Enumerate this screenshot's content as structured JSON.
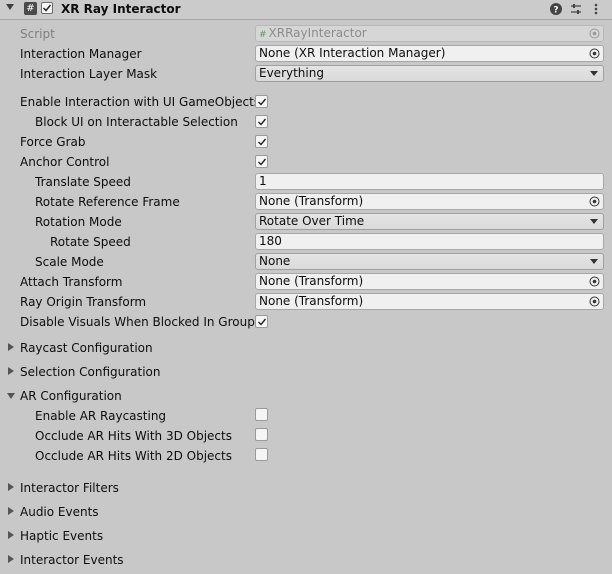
{
  "component": {
    "title": "XR Ray Interactor",
    "enabled": true,
    "icons": [
      "help-icon",
      "presets-icon",
      "more-options-icon"
    ]
  },
  "fields": {
    "script": {
      "label": "Script",
      "value": "XRRayInteractor"
    },
    "interaction_manager": {
      "label": "Interaction Manager",
      "value": "None (XR Interaction Manager)"
    },
    "interaction_layer_mask": {
      "label": "Interaction Layer Mask",
      "value": "Everything"
    },
    "enable_ui": {
      "label": "Enable Interaction with UI GameObjects",
      "checked": true
    },
    "block_ui": {
      "label": "Block UI on Interactable Selection",
      "checked": true
    },
    "force_grab": {
      "label": "Force Grab",
      "checked": true
    },
    "anchor_control": {
      "label": "Anchor Control",
      "checked": true
    },
    "translate_speed": {
      "label": "Translate Speed",
      "value": "1"
    },
    "rotate_reference_frame": {
      "label": "Rotate Reference Frame",
      "value": "None (Transform)"
    },
    "rotation_mode": {
      "label": "Rotation Mode",
      "value": "Rotate Over Time"
    },
    "rotate_speed": {
      "label": "Rotate Speed",
      "value": "180"
    },
    "scale_mode": {
      "label": "Scale Mode",
      "value": "None"
    },
    "attach_transform": {
      "label": "Attach Transform",
      "value": "None (Transform)"
    },
    "ray_origin_transform": {
      "label": "Ray Origin Transform",
      "value": "None (Transform)"
    },
    "disable_visuals": {
      "label": "Disable Visuals When Blocked In Group",
      "checked": true
    }
  },
  "sections": {
    "raycast": "Raycast Configuration",
    "selection": "Selection Configuration",
    "ar": "AR Configuration",
    "filters": "Interactor Filters",
    "audio": "Audio Events",
    "haptic": "Haptic Events",
    "interactor_events": "Interactor Events"
  },
  "ar": {
    "enable_ar_raycasting": {
      "label": "Enable AR Raycasting",
      "checked": false
    },
    "occlude_3d": {
      "label": "Occlude AR Hits With 3D Objects",
      "checked": false
    },
    "occlude_2d": {
      "label": "Occlude AR Hits With 2D Objects",
      "checked": false
    }
  }
}
